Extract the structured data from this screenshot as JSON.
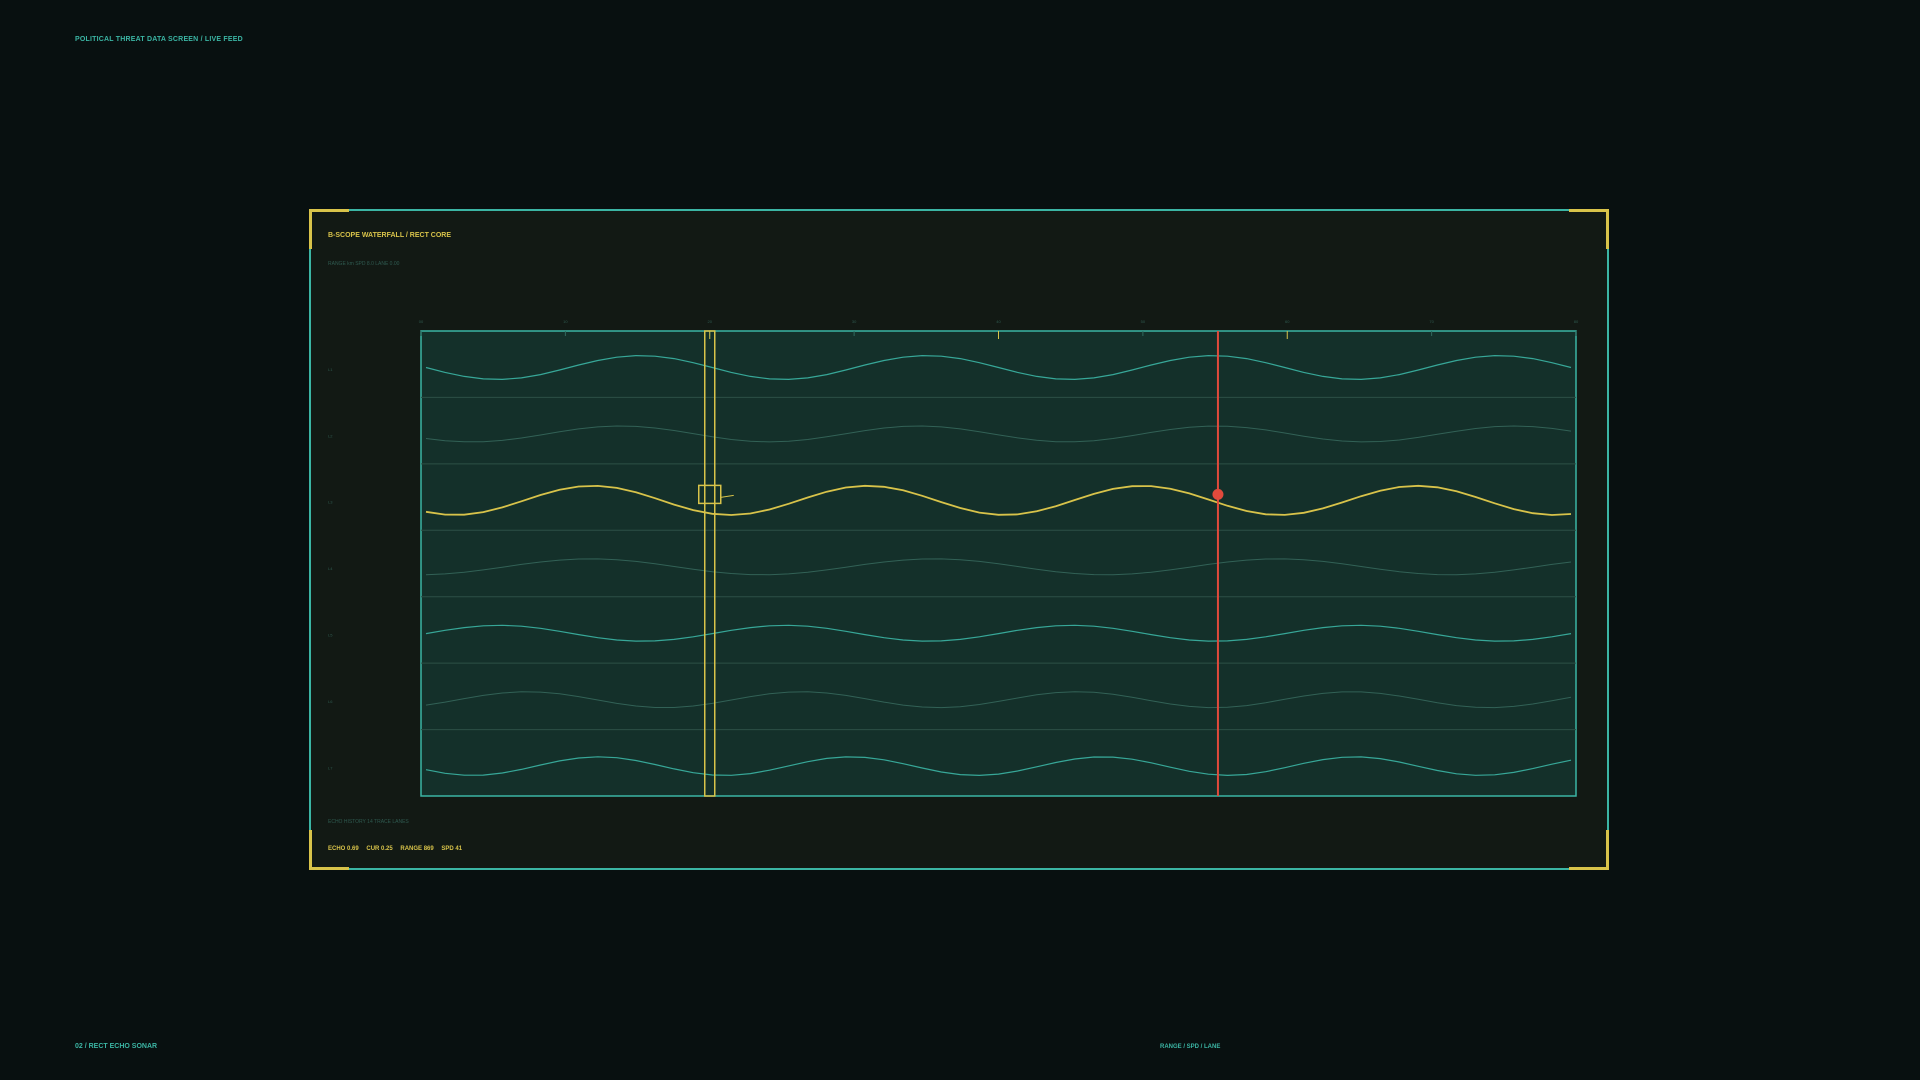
{
  "header": {
    "title": "POLITICAL THREAT DATA SCREEN / LIVE FEED"
  },
  "panel": {
    "title": "B-SCOPE WATERFALL / RECT CORE",
    "subtitle": "RANGE km SPD 8.0 LANE 0.00",
    "note": "ECHO HISTORY 14 TRACE LANES",
    "readout": [
      "ECHO 0.69",
      "CUR 0.25",
      "RANGE 869",
      "SPD 41"
    ]
  },
  "footer": {
    "left": "02 / RECT ECHO SONAR",
    "center": "RANGE / SPD / LANE"
  },
  "colors": {
    "background": "#081010",
    "panel": "#121914",
    "accent_teal": "#3bb5a4",
    "accent_yellow": "#d8c34a",
    "alert_red": "#e04a3c",
    "plot_fill": "#14302a",
    "dim_text": "#2f5a50"
  },
  "chart_data": {
    "type": "line",
    "x_ticks": [
      "00",
      "10",
      "20",
      "30",
      "40",
      "50",
      "60",
      "70",
      "80"
    ],
    "lane_labels": [
      "L1",
      "L2",
      "L3",
      "L4",
      "L5",
      "L6",
      "L7"
    ],
    "lanes": [
      {
        "lane": "L1",
        "style": "teal",
        "amplitude": 0.45,
        "period": 0.25,
        "phase": 0.0
      },
      {
        "lane": "L2",
        "style": "dim",
        "amplitude": 0.3,
        "period": 0.26,
        "phase": 0.6
      },
      {
        "lane": "L3",
        "style": "highlight",
        "amplitude": 0.55,
        "period": 0.24,
        "phase": 0.9
      },
      {
        "lane": "L4",
        "style": "dim",
        "amplitude": 0.3,
        "period": 0.3,
        "phase": 1.7
      },
      {
        "lane": "L5",
        "style": "teal",
        "amplitude": 0.3,
        "period": 0.25,
        "phase": 3.1
      },
      {
        "lane": "L6",
        "style": "dim",
        "amplitude": 0.3,
        "period": 0.24,
        "phase": 2.4
      },
      {
        "lane": "L7",
        "style": "teal",
        "amplitude": 0.35,
        "period": 0.22,
        "phase": 0.4
      }
    ],
    "cursor_position": 0.25,
    "alert_position": 0.69,
    "alert_lane": "L3"
  }
}
